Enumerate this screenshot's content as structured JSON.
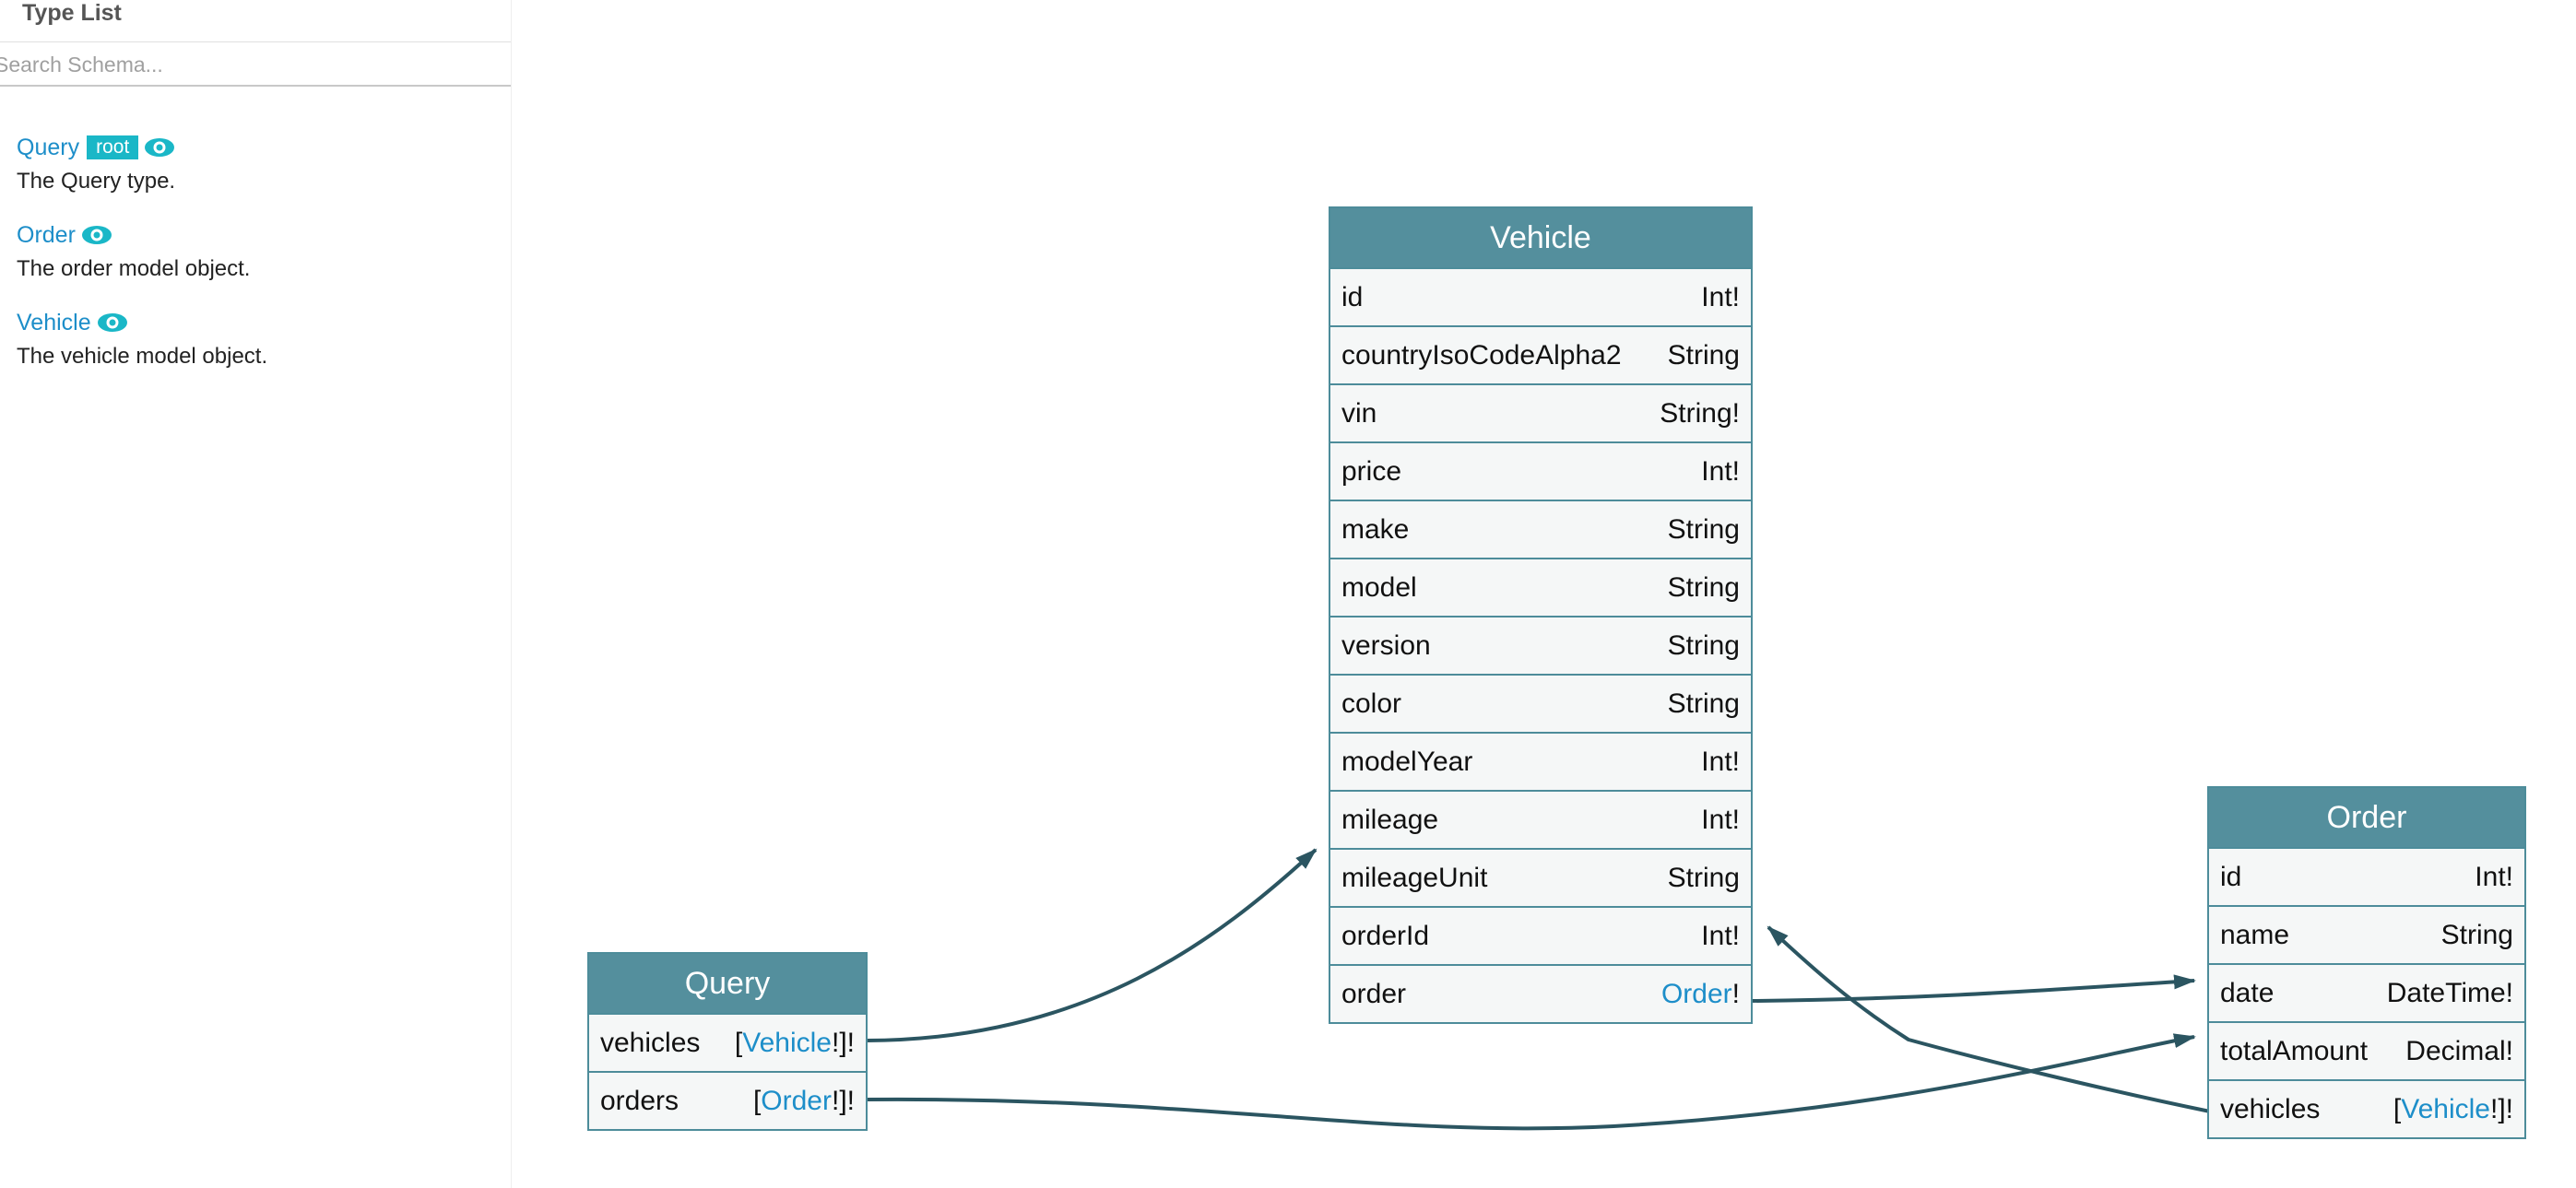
{
  "sidebar": {
    "title": "Type List",
    "search": {
      "placeholder": "Search Schema...",
      "value": ""
    },
    "types": [
      {
        "name": "Query",
        "badge": "root",
        "description": "The Query type."
      },
      {
        "name": "Order",
        "description": "The order model object."
      },
      {
        "name": "Vehicle",
        "description": "The vehicle model object."
      }
    ]
  },
  "diagram": {
    "nodes": {
      "vehicle": {
        "title": "Vehicle",
        "fields": [
          {
            "name": "id",
            "type": "Int!"
          },
          {
            "name": "countryIsoCodeAlpha2",
            "type": "String"
          },
          {
            "name": "vin",
            "type": "String!"
          },
          {
            "name": "price",
            "type": "Int!"
          },
          {
            "name": "make",
            "type": "String"
          },
          {
            "name": "model",
            "type": "String"
          },
          {
            "name": "version",
            "type": "String"
          },
          {
            "name": "color",
            "type": "String"
          },
          {
            "name": "modelYear",
            "type": "Int!"
          },
          {
            "name": "mileage",
            "type": "Int!"
          },
          {
            "name": "mileageUnit",
            "type": "String"
          },
          {
            "name": "orderId",
            "type": "Int!"
          },
          {
            "name": "order",
            "type_link": "Order",
            "type_suffix": "!"
          }
        ]
      },
      "query": {
        "title": "Query",
        "fields": [
          {
            "name": "vehicles",
            "type_prefix": "[",
            "type_link": "Vehicle",
            "type_suffix": "!]!"
          },
          {
            "name": "orders",
            "type_prefix": "[",
            "type_link": "Order",
            "type_suffix": "!]!"
          }
        ]
      },
      "order": {
        "title": "Order",
        "fields": [
          {
            "name": "id",
            "type": "Int!"
          },
          {
            "name": "name",
            "type": "String"
          },
          {
            "name": "date",
            "type": "DateTime!"
          },
          {
            "name": "totalAmount",
            "type": "Decimal!"
          },
          {
            "name": "vehicles",
            "type_prefix": "[",
            "type_link": "Vehicle",
            "type_suffix": "!]!"
          }
        ]
      }
    },
    "colors": {
      "header": "#548f9d",
      "border": "#4d8c9a",
      "link": "#1d8ec9",
      "edge": "#2b5561",
      "badge": "#1ab7c7"
    }
  }
}
